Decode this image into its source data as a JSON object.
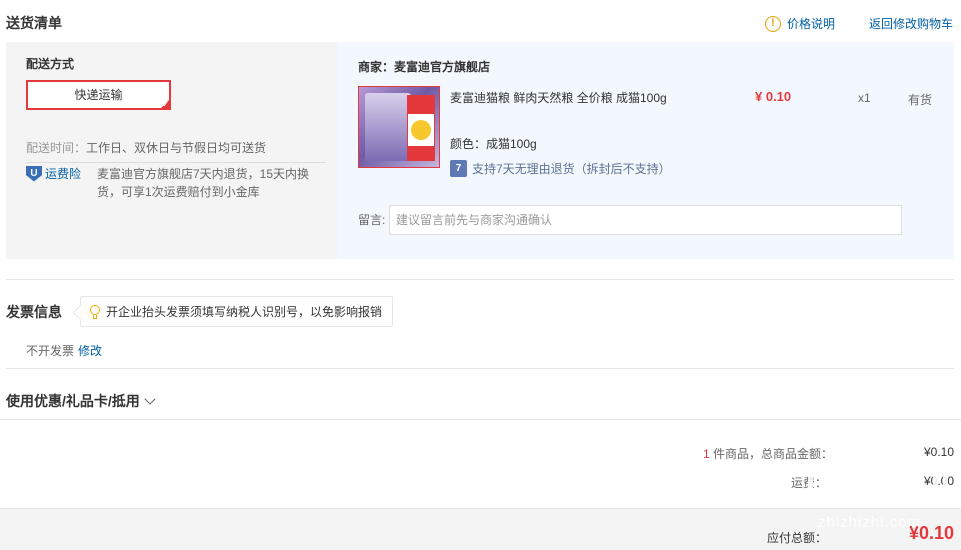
{
  "header": {
    "title": "送货清单",
    "price_note": "价格说明",
    "back_to_cart": "返回修改购物车"
  },
  "delivery": {
    "method_label": "配送方式",
    "method_option": "快递运输",
    "time_label": "配送时间：",
    "time_value": "工作日、双休日与节假日均可送货",
    "insurance_label": "运费险",
    "insurance_desc": "麦富迪官方旗舰店7天内退货，15天内换货，可享1次运费赔付到小金库"
  },
  "order": {
    "merchant": "商家：麦富迪官方旗舰店",
    "product": {
      "name": "麦富迪猫粮 鲜肉天然粮 全价粮 成猫100g",
      "price": "¥ 0.10",
      "quantity": "x1",
      "stock": "有货",
      "color": "颜色：成猫100g",
      "return_policy": "支持7天无理由退货（拆封后不支持）"
    },
    "note_label": "留言:",
    "note_placeholder": "建议留言前先与商家沟通确认"
  },
  "invoice": {
    "title": "发票信息",
    "tip": "开企业抬头发票须填写纳税人识别号，以免影响报销",
    "status": "不开发票",
    "edit": "修改"
  },
  "coupon": {
    "title": "使用优惠/礼品卡/抵用"
  },
  "summary": {
    "item_count": "1",
    "item_count_suffix": " 件商品，总商品金额：",
    "goods_amount": "¥0.10",
    "freight_label": "运费：",
    "freight": "¥0.00",
    "payable_label": "应付总额：",
    "payable": "¥0.10"
  },
  "watermark": "zhizhizhi.com",
  "colors": {
    "accent_red": "#e4393c",
    "link_blue": "#005ea7"
  }
}
